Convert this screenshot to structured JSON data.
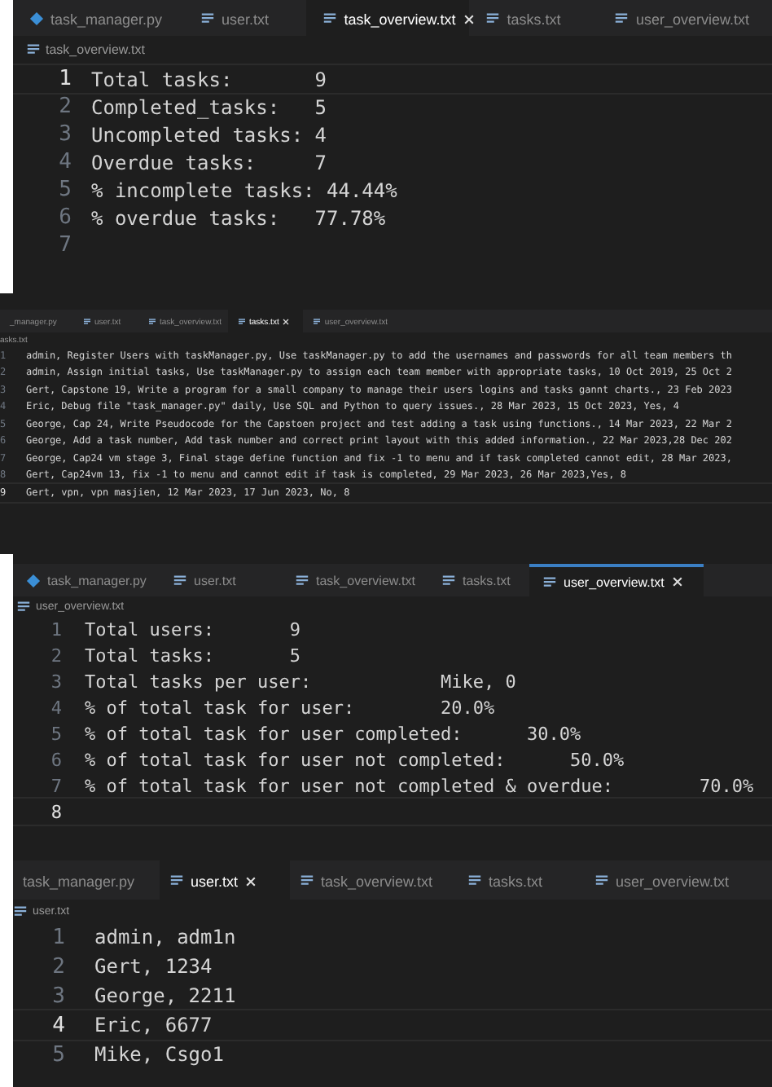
{
  "editors": [
    {
      "tabs": [
        {
          "label": "task_manager.py",
          "kind": "python",
          "selected": false
        },
        {
          "label": "user.txt",
          "kind": "text",
          "selected": false
        },
        {
          "label": "task_overview.txt",
          "kind": "text",
          "selected": true
        },
        {
          "label": "tasks.txt",
          "kind": "text",
          "selected": false
        },
        {
          "label": "user_overview.txt",
          "kind": "text",
          "selected": false
        }
      ],
      "breadcrumb": "task_overview.txt",
      "lines": [
        {
          "number": "1",
          "text": "Total tasks:       9",
          "current": true
        },
        {
          "number": "2",
          "text": "Completed_tasks:   5",
          "current": false
        },
        {
          "number": "3",
          "text": "Uncompleted tasks: 4",
          "current": false
        },
        {
          "number": "4",
          "text": "Overdue tasks:     7",
          "current": false
        },
        {
          "number": "5",
          "text": "% incomplete tasks: 44.44%",
          "current": false
        },
        {
          "number": "6",
          "text": "% overdue tasks:   77.78%",
          "current": false
        },
        {
          "number": "7",
          "current": false
        }
      ]
    },
    {
      "tabs": [
        {
          "label": "_manager.py",
          "kind": "plain",
          "selected": false
        },
        {
          "label": "user.txt",
          "kind": "text",
          "selected": false
        },
        {
          "label": "task_overview.txt",
          "kind": "text",
          "selected": false
        },
        {
          "label": "tasks.txt",
          "kind": "text",
          "selected": true
        },
        {
          "label": "user_overview.txt",
          "kind": "text",
          "selected": false
        }
      ],
      "breadcrumb": "asks.txt",
      "lines": [
        {
          "number": "1",
          "text": "admin, Register Users with taskManager.py, Use taskManager.py to add the usernames and passwords for all team members th",
          "current": false
        },
        {
          "number": "2",
          "text": "admin, Assign initial tasks, Use taskManager.py to assign each team member with appropriate tasks, 10 Oct 2019, 25 Oct 2",
          "current": false
        },
        {
          "number": "3",
          "text": "Gert, Capstone 19, Write a program for a small company to manage their users logins and tasks gannt charts., 23 Feb 2023",
          "current": false
        },
        {
          "number": "4",
          "text": "Eric, Debug file \"task_manager.py\" daily, Use SQL and Python to query issues., 28 Mar 2023, 15 Oct 2023, Yes, 4",
          "current": false
        },
        {
          "number": "5",
          "text": "George, Cap 24, Write Pseudocode for the Capstoen project and test adding a task using functions., 14 Mar 2023, 22 Mar 2",
          "current": false
        },
        {
          "number": "6",
          "text": "George, Add a task number, Add task number and correct print layout with this added information., 22 Mar 2023,28 Dec 202",
          "current": false
        },
        {
          "number": "7",
          "text": "George, Cap24 vm stage 3, Final stage define function and fix -1 to menu and if task completed cannot edit, 28 Mar 2023,",
          "current": false
        },
        {
          "number": "8",
          "text": "Gert, Cap24vm 13, fix -1 to menu and cannot edit if task is completed, 29 Mar 2023, 26 Mar 2023,Yes, 8",
          "current": false
        },
        {
          "number": "9",
          "text": "Gert, vpn, vpn masjien, 12 Mar 2023, 17 Jun 2023, No, 8",
          "current": true
        }
      ]
    },
    {
      "tabs": [
        {
          "label": "task_manager.py",
          "kind": "python",
          "selected": false
        },
        {
          "label": "user.txt",
          "kind": "text",
          "selected": false
        },
        {
          "label": "task_overview.txt",
          "kind": "text",
          "selected": false
        },
        {
          "label": "tasks.txt",
          "kind": "text",
          "selected": false
        },
        {
          "label": "user_overview.txt",
          "kind": "text",
          "selected": true
        }
      ],
      "breadcrumb": "user_overview.txt",
      "lines": [
        {
          "number": "1",
          "text": "Total users:       9",
          "current": false
        },
        {
          "number": "2",
          "text": "Total tasks:       5",
          "current": false
        },
        {
          "number": "3",
          "text": "Total tasks per user:            Mike, 0",
          "current": false
        },
        {
          "number": "4",
          "text": "% of total task for user:        20.0%",
          "current": false
        },
        {
          "number": "5",
          "text": "% of total task for user completed:      30.0%",
          "current": false
        },
        {
          "number": "6",
          "text": "% of total task for user not completed:      50.0%",
          "current": false
        },
        {
          "number": "7",
          "text": "% of total task for user not completed & overdue:        70.0%",
          "current": false
        },
        {
          "number": "8",
          "current": true
        }
      ]
    },
    {
      "tabs": [
        {
          "label": "task_manager.py",
          "kind": "plain",
          "selected": false
        },
        {
          "label": "user.txt",
          "kind": "text",
          "selected": true
        },
        {
          "label": "task_overview.txt",
          "kind": "text",
          "selected": false
        },
        {
          "label": "tasks.txt",
          "kind": "text",
          "selected": false
        },
        {
          "label": "user_overview.txt",
          "kind": "text",
          "selected": false
        }
      ],
      "breadcrumb": "user.txt",
      "lines": [
        {
          "number": "1",
          "text": "admin, adm1n",
          "current": false
        },
        {
          "number": "2",
          "text": "Gert, 1234",
          "current": false
        },
        {
          "number": "3",
          "text": "George, 2211",
          "current": false
        },
        {
          "number": "4",
          "text": "Eric, 6677",
          "current": true
        },
        {
          "number": "5",
          "text": "Mike, Csgo1",
          "current": false
        }
      ]
    }
  ]
}
